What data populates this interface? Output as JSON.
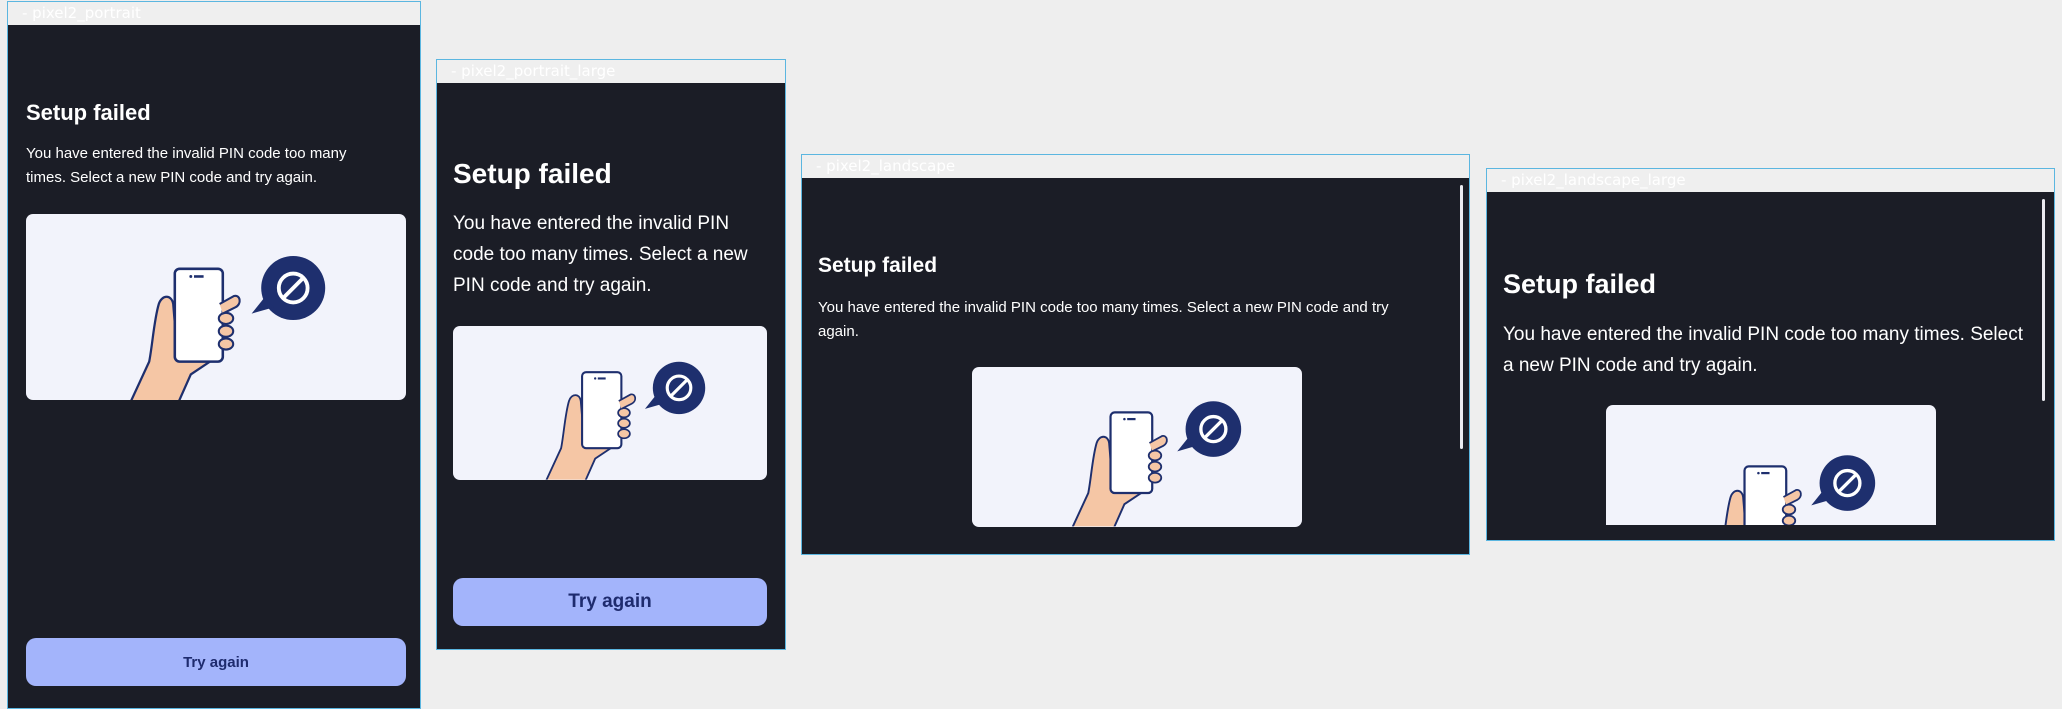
{
  "frames": [
    {
      "label": "- pixel2_portrait",
      "title": "Setup failed",
      "message": "You have entered the invalid PIN code too many times. Select a new PIN code and try again.",
      "button_label": "Try again"
    },
    {
      "label": "- pixel2_portrait_large",
      "title": "Setup failed",
      "message": "You have entered the invalid PIN code too many times. Select a new PIN code and try again.",
      "button_label": "Try again"
    },
    {
      "label": "- pixel2_landscape",
      "title": "Setup failed",
      "message": "You have entered the invalid PIN code too many times. Select a new PIN code and try again."
    },
    {
      "label": "- pixel2_landscape_large",
      "title": "Setup failed",
      "message": "You have entered the invalid PIN code too many times. Select a new PIN code and try again."
    }
  ],
  "illustration": {
    "icons": [
      "hand-holding-phone-icon",
      "blocked-speech-bubble-icon"
    ]
  },
  "colors": {
    "canvas": "#eeeeee",
    "screen_bg": "#1b1d26",
    "frame_outline": "#5bb6e0",
    "illustration_bg": "#f2f3fb",
    "button_bg": "#a3b4fb",
    "button_text": "#1e2b6e",
    "badge_bg": "#1e2f6e"
  }
}
